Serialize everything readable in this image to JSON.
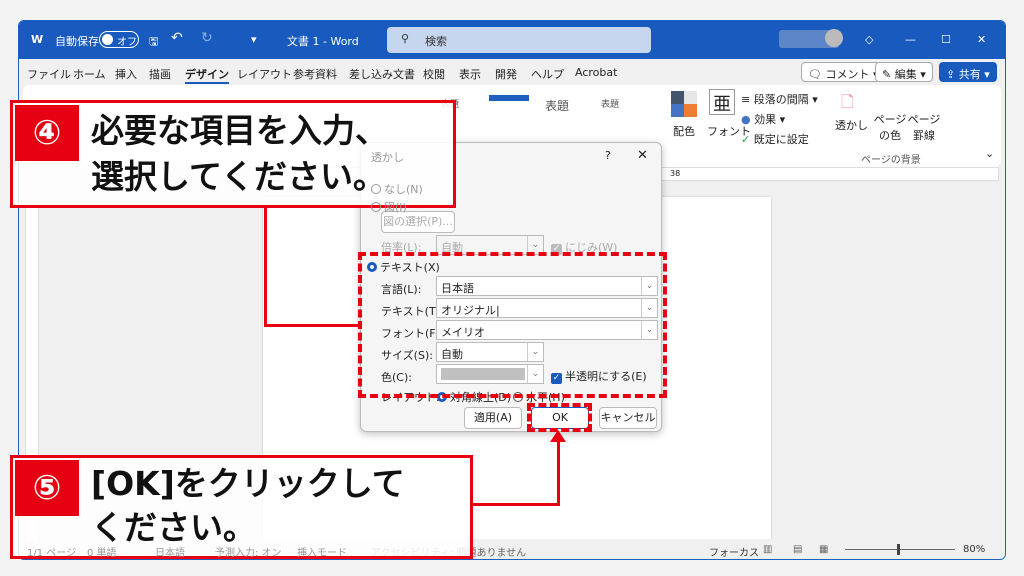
{
  "title_bar": {
    "autosave_label": "自動保存",
    "autosave_state": "オフ",
    "doc_title": "文書 1 - Word",
    "search_placeholder": "検索"
  },
  "tabs": [
    "ファイル",
    "ホーム",
    "挿入",
    "描画",
    "デザイン",
    "レイアウト",
    "参考資料",
    "差し込み文書",
    "校閲",
    "表示",
    "開発",
    "ヘルプ",
    "Acrobat"
  ],
  "active_tab": "デザイン",
  "top_buttons": {
    "comment": "コメント",
    "edit": "編集",
    "share": "共有"
  },
  "ribbon": {
    "style_labels": [
      "表題",
      "表題",
      "表題",
      "表題",
      "表題",
      "表題",
      "表題",
      "表題",
      "表題"
    ],
    "colors": "配色",
    "fonts": "フォント",
    "paragraph_spacing": "段落の間隔",
    "effects": "効果",
    "set_default": "既定に設定",
    "watermark": "透かし",
    "page_color": "ページの色",
    "page_border": "ページ罫線",
    "group_label": "ページの背景"
  },
  "accent_color": "#185abd",
  "dialog": {
    "title": "透かし",
    "help": "?",
    "close": "✕",
    "none": "なし(N)",
    "picture": "図(I)",
    "select_picture": "図の選択(P)...",
    "scale_label": "倍率(L):",
    "scale_value": "自動",
    "washout": "にじみ(W)",
    "text_option": "テキスト(X)",
    "language_label": "言語(L):",
    "language_value": "日本語",
    "text_label": "テキスト(T):",
    "text_value": "オリジナル",
    "font_label": "フォント(F):",
    "font_value": "メイリオ",
    "size_label": "サイズ(S):",
    "size_value": "自動",
    "color_label": "色(C):",
    "semitransparent": "半透明にする(E)",
    "layout_label": "レイアウト:",
    "diagonal": "対角線上(D)",
    "horizontal": "水平(H)",
    "apply": "適用(A)",
    "ok": "OK",
    "cancel": "キャンセル"
  },
  "ruler_mark": "38",
  "status": {
    "page": "1/1 ページ",
    "words": "0 単語",
    "language": "日本語",
    "predict": "予測入力: オン",
    "insert_mode": "挿入モード",
    "accessibility": "アクセシビリティ: 問題ありません",
    "focus": "フォーカス",
    "zoom": "80%"
  },
  "callouts": {
    "step4_num": "④",
    "step4_line1": "必要な項目を入力、",
    "step4_line2": "選択してください。",
    "step5_num": "⑤",
    "step5_line1": "[OK]をクリックして",
    "step5_line2": "ください。"
  },
  "highlight_color": "#e60012"
}
